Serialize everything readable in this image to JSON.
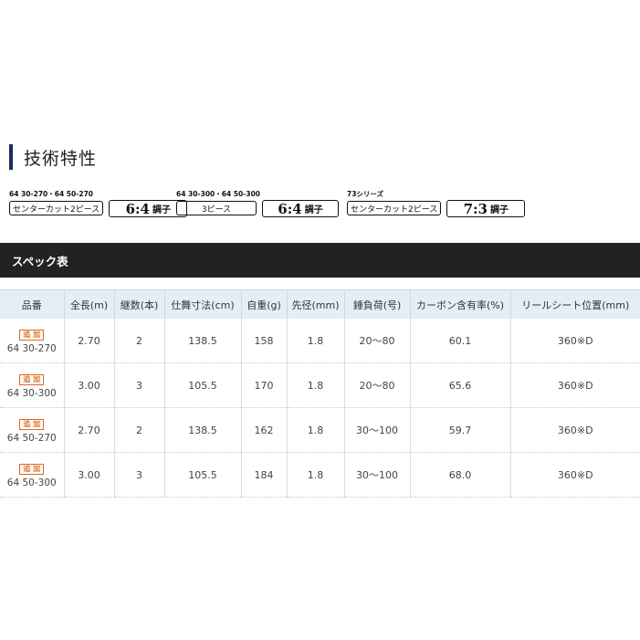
{
  "section_title": "技術特性",
  "features": [
    {
      "caption": "64 30-270・64 50-270",
      "label": "センターカット2ピース",
      "ratio": "6:4",
      "ratio_suffix": "調子"
    },
    {
      "caption": "64 30-300・64 50-300",
      "label": "3ピース",
      "ratio": "6:4",
      "ratio_suffix": "調子"
    },
    {
      "caption": "73シリーズ",
      "label": "センターカット2ピース",
      "ratio": "7:3",
      "ratio_suffix": "調子"
    }
  ],
  "spec_header": "スペック表",
  "table": {
    "columns": [
      "品番",
      "全長(m)",
      "継数(本)",
      "仕舞寸法(cm)",
      "自重(g)",
      "先径(mm)",
      "錘負荷(号)",
      "カーボン含有率(%)",
      "リールシート位置(mm)"
    ],
    "rows": [
      {
        "badge": "追 加",
        "model": "64 30-270",
        "length": "2.70",
        "pieces": "2",
        "closed": "138.5",
        "weight": "158",
        "tip": "1.8",
        "load": "20〜80",
        "carbon": "60.1",
        "reel": "360※D"
      },
      {
        "badge": "追 加",
        "model": "64 30-300",
        "length": "3.00",
        "pieces": "3",
        "closed": "105.5",
        "weight": "170",
        "tip": "1.8",
        "load": "20〜80",
        "carbon": "65.6",
        "reel": "360※D"
      },
      {
        "badge": "追 加",
        "model": "64 50-270",
        "length": "2.70",
        "pieces": "2",
        "closed": "138.5",
        "weight": "162",
        "tip": "1.8",
        "load": "30〜100",
        "carbon": "59.7",
        "reel": "360※D"
      },
      {
        "badge": "追 加",
        "model": "64 50-300",
        "length": "3.00",
        "pieces": "3",
        "closed": "105.5",
        "weight": "184",
        "tip": "1.8",
        "load": "30〜100",
        "carbon": "68.0",
        "reel": "360※D"
      }
    ]
  }
}
